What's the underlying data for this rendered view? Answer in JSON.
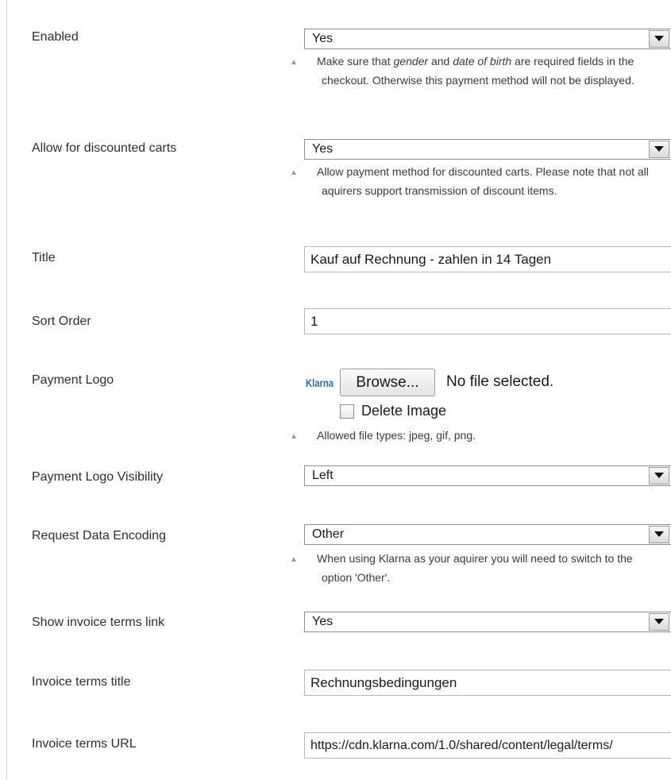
{
  "rows": {
    "enabled": {
      "label": "Enabled",
      "value": "Yes",
      "note_parts": [
        "Make sure that ",
        "gender",
        " and ",
        "date of birth",
        " are required fields in the checkout. Otherwise this payment method will not be displayed."
      ]
    },
    "discounted": {
      "label": "Allow for discounted carts",
      "value": "Yes",
      "note": "Allow payment method for discounted carts. Please note that not all aquirers support transmission of discount items."
    },
    "title": {
      "label": "Title",
      "value": "Kauf auf Rechnung - zahlen in 14 Tagen"
    },
    "sort_order": {
      "label": "Sort Order",
      "value": "1"
    },
    "payment_logo": {
      "label": "Payment Logo",
      "logo_text": "Klarna",
      "browse_label": "Browse...",
      "no_file": "No file selected.",
      "delete_label": "Delete Image",
      "note": "Allowed file types: jpeg, gif, png."
    },
    "logo_visibility": {
      "label": "Payment Logo Visibility",
      "value": "Left"
    },
    "encoding": {
      "label": "Request Data Encoding",
      "value": "Other",
      "note": "When using Klarna as your aquirer you will need to switch to the option 'Other'."
    },
    "invoice_link": {
      "label": "Show invoice terms link",
      "value": "Yes"
    },
    "invoice_title": {
      "label": "Invoice terms title",
      "value": "Rechnungsbedingungen"
    },
    "invoice_url": {
      "label": "Invoice terms URL",
      "value": "https://cdn.klarna.com/1.0/shared/content/legal/terms/"
    }
  },
  "icons": {
    "dropdown": "chevron-down-icon",
    "note": "triangle-up-icon",
    "logo": "klarna-logo"
  }
}
